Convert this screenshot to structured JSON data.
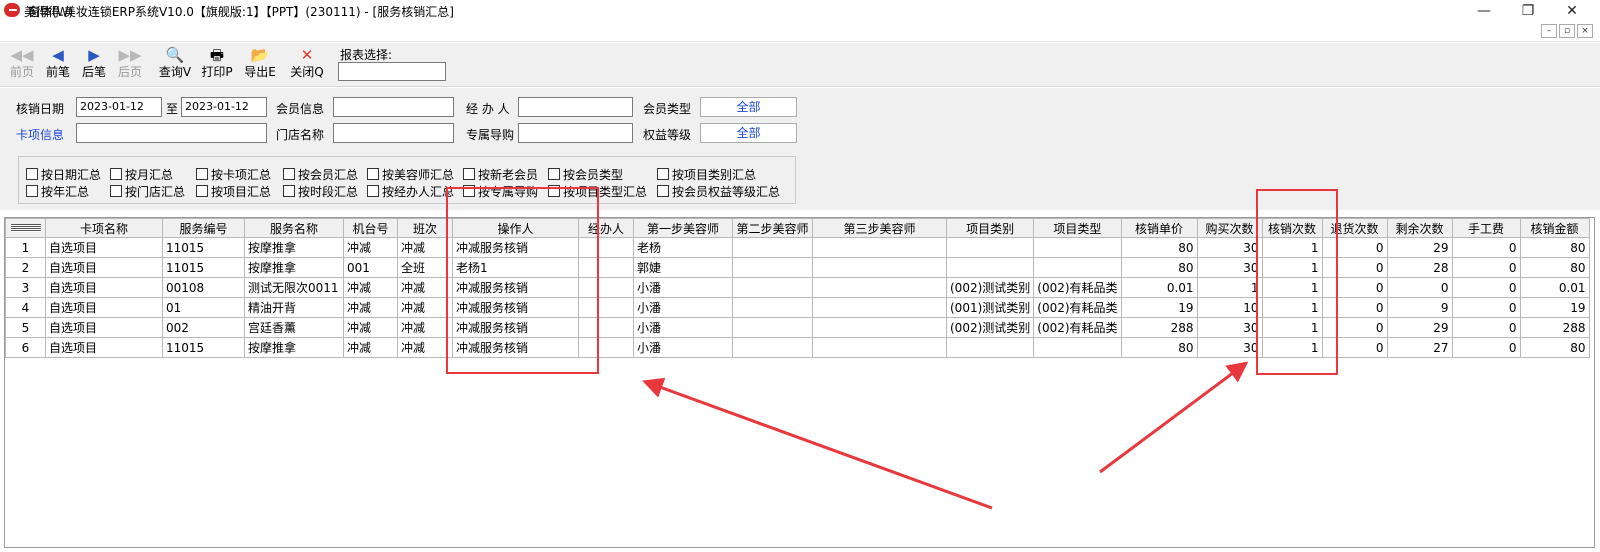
{
  "window": {
    "title": "美得得.美妆连锁ERP系统V10.0【旗舰版:1】【PPT】(230111) - [服务核销汇总]",
    "controls": [
      "—",
      "❐",
      "✕"
    ]
  },
  "menu": {
    "item": "窗体(W)",
    "mdi_controls": [
      "–",
      "▫",
      "×"
    ]
  },
  "toolbar": {
    "buttons": [
      {
        "label": "前页",
        "icon": "◀◀"
      },
      {
        "label": "前笔",
        "icon": "◀"
      },
      {
        "label": "后笔",
        "icon": "▶"
      },
      {
        "label": "后页",
        "icon": "▶▶"
      },
      {
        "label": "查询V",
        "icon": "🔍"
      },
      {
        "label": "打印P",
        "icon": "🖶"
      },
      {
        "label": "导出E",
        "icon": "📂"
      },
      {
        "label": "关闭Q",
        "icon": "✕"
      }
    ],
    "report_label": "报表选择:",
    "report_value": ""
  },
  "filters": {
    "date_label": "核销日期",
    "date_from": "2023-01-12",
    "to_label": "至",
    "date_to": "2023-01-12",
    "member_label": "会员信息",
    "member_value": "",
    "handler_label": "经 办 人",
    "handler_value": "",
    "member_type_label": "会员类型",
    "member_type_value": "全部",
    "card_label": "卡项信息",
    "card_value": "",
    "store_label": "门店名称",
    "store_value": "",
    "guide_label": "专属导购",
    "guide_value": "",
    "rights_label": "权益等级",
    "rights_value": "全部"
  },
  "checkboxes": {
    "row1": [
      "按日期汇总",
      "按月汇总",
      "按卡项汇总",
      "按会员汇总",
      "按美容师汇总",
      "按新老会员",
      "按会员类型",
      "按项目类别汇总"
    ],
    "row2": [
      "按年汇总",
      "按门店汇总",
      "按项目汇总",
      "按时段汇总",
      "按经办人汇总",
      "按专属导购",
      "按项目类型汇总",
      "按会员权益等级汇总"
    ]
  },
  "table": {
    "headers": [
      "卡项名称",
      "服务编号",
      "服务名称",
      "机台号",
      "班次",
      "操作人",
      "经办人",
      "第一步美容师",
      "第二步美容师",
      "第三步美容师",
      "项目类别",
      "项目类型",
      "核销单价",
      "购买次数",
      "核销次数",
      "退货次数",
      "剩余次数",
      "手工费",
      "核销金额"
    ],
    "rows": [
      {
        "no": "1",
        "cells": [
          "自选项目",
          "11015",
          "按摩推拿",
          "冲减",
          "冲减",
          "冲减服务核销",
          "",
          "老杨",
          "",
          "",
          "",
          "",
          "80",
          "30",
          "1",
          "0",
          "29",
          "0",
          "80"
        ]
      },
      {
        "no": "2",
        "cells": [
          "自选项目",
          "11015",
          "按摩推拿",
          "001",
          "全班",
          "老杨1",
          "",
          "郭婕",
          "",
          "",
          "",
          "",
          "80",
          "30",
          "1",
          "0",
          "28",
          "0",
          "80"
        ]
      },
      {
        "no": "3",
        "cells": [
          "自选项目",
          "00108",
          "测试无限次0011",
          "冲减",
          "冲减",
          "冲减服务核销",
          "",
          "小潘",
          "",
          "",
          "(002)测试类别",
          "(002)有耗品类",
          "0.01",
          "1",
          "1",
          "0",
          "0",
          "0",
          "0.01"
        ]
      },
      {
        "no": "4",
        "cells": [
          "自选项目",
          "01",
          "精油开背",
          "冲减",
          "冲减",
          "冲减服务核销",
          "",
          "小潘",
          "",
          "",
          "(001)测试类别",
          "(002)有耗品类",
          "19",
          "10",
          "1",
          "0",
          "9",
          "0",
          "19"
        ]
      },
      {
        "no": "5",
        "cells": [
          "自选项目",
          "002",
          "宫廷香薰",
          "冲减",
          "冲减",
          "冲减服务核销",
          "",
          "小潘",
          "",
          "",
          "(002)测试类别",
          "(002)有耗品类",
          "288",
          "30",
          "1",
          "0",
          "29",
          "0",
          "288"
        ]
      },
      {
        "no": "6",
        "cells": [
          "自选项目",
          "11015",
          "按摩推拿",
          "冲减",
          "冲减",
          "冲减服务核销",
          "",
          "小潘",
          "",
          "",
          "",
          "",
          "80",
          "30",
          "1",
          "0",
          "27",
          "0",
          "80"
        ]
      }
    ]
  },
  "annotation_color": "#e8383d"
}
